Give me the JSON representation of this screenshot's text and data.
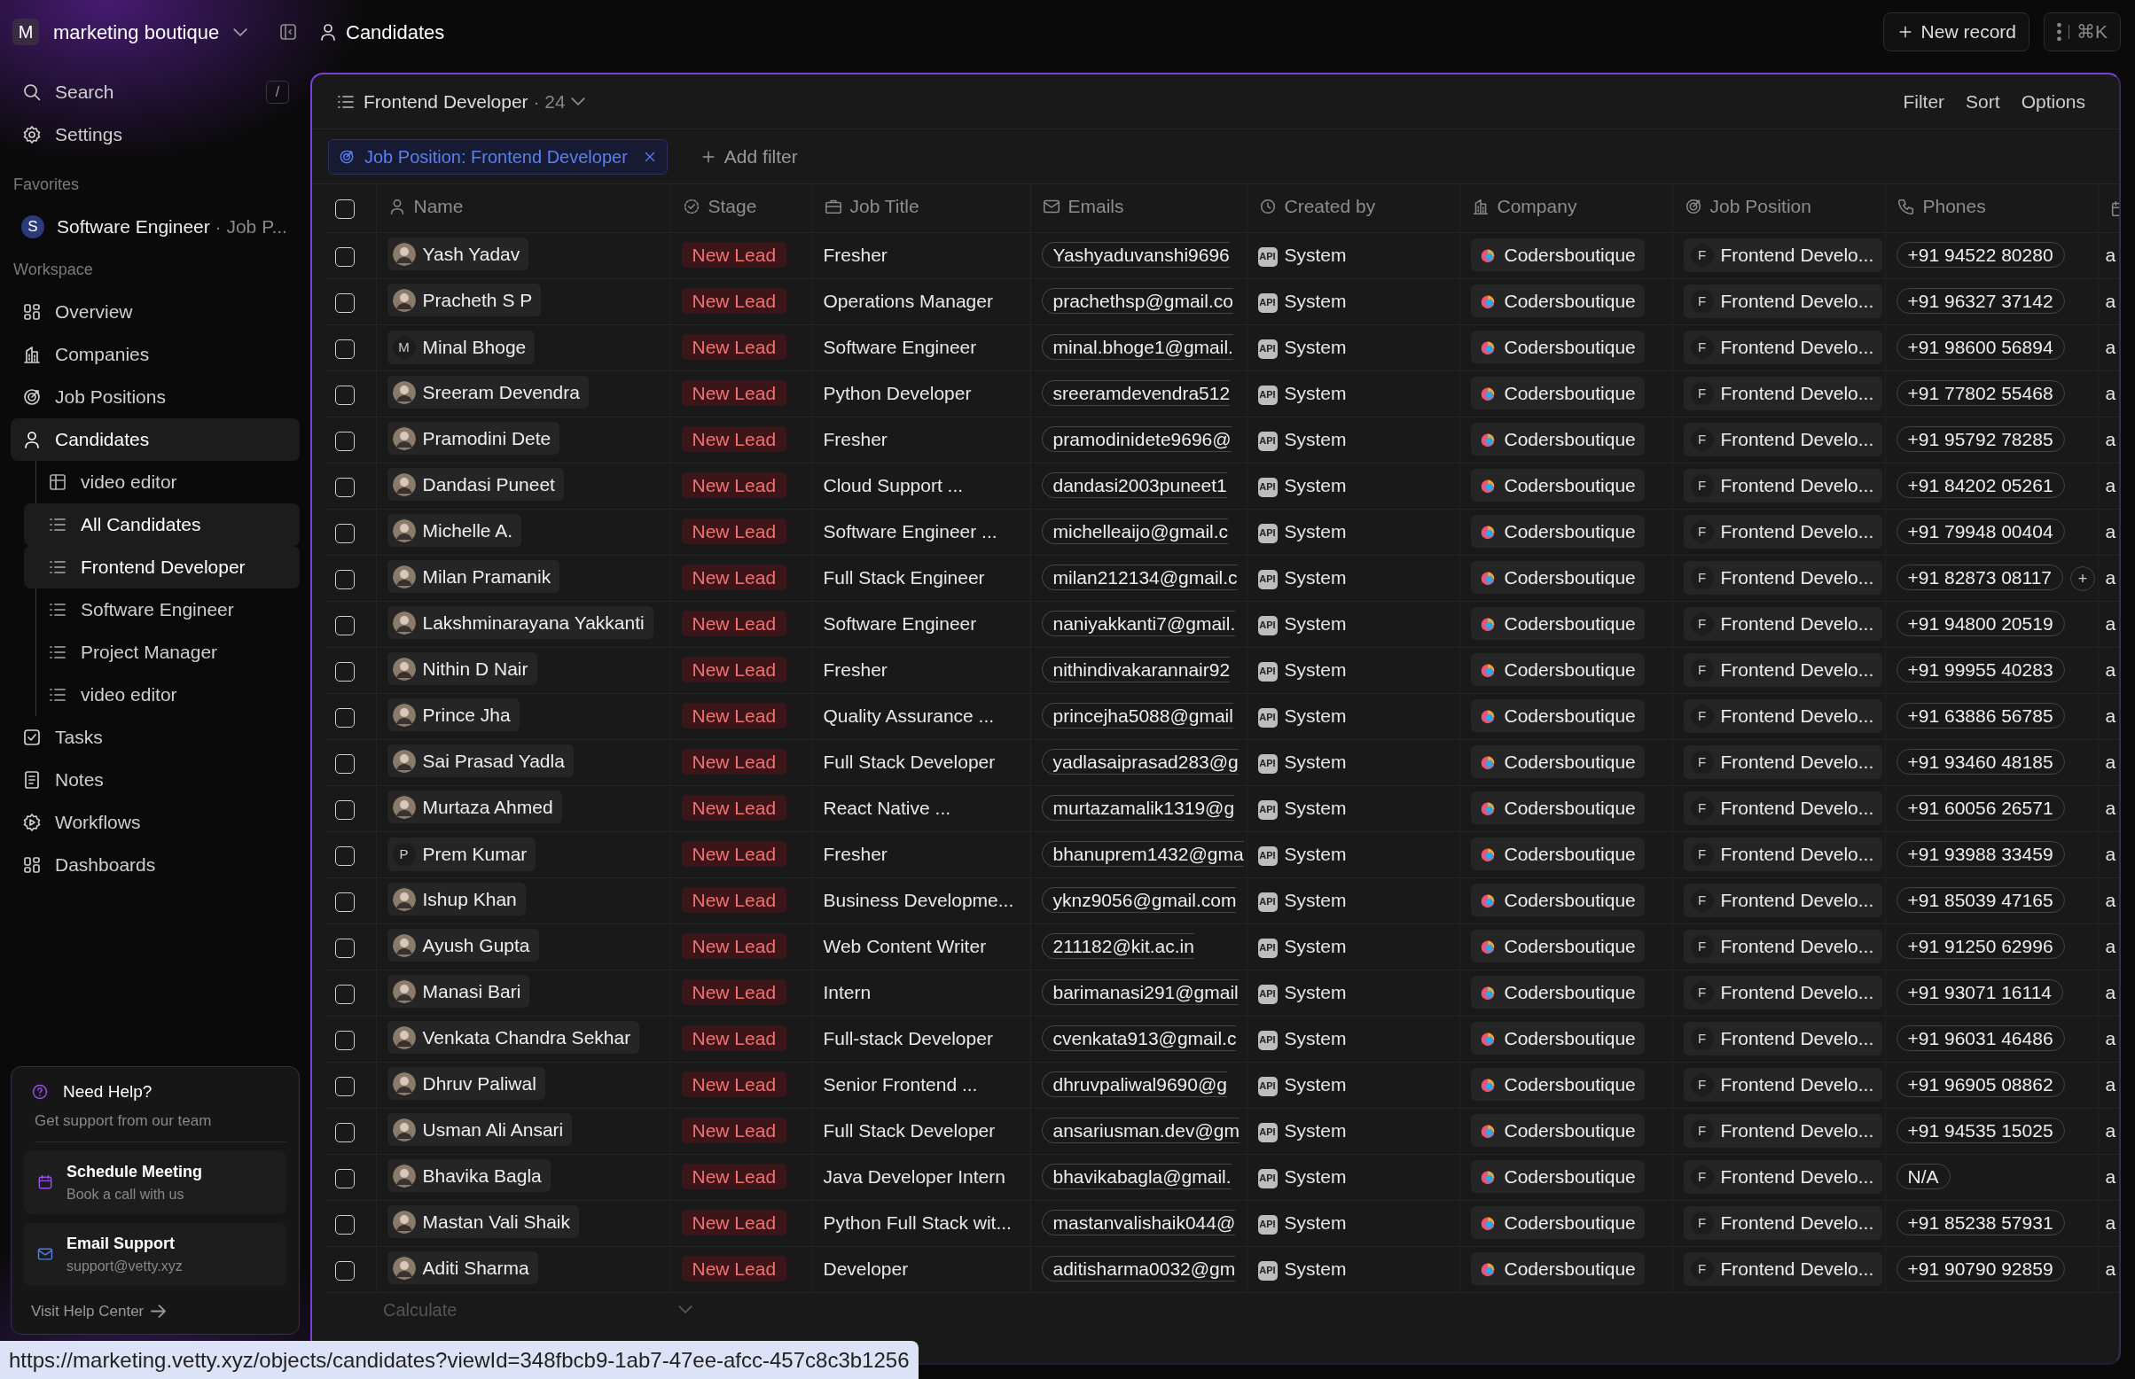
{
  "topbar": {
    "workspace_letter": "M",
    "workspace": "marketing boutique",
    "page": "Candidates",
    "new_record": "New record",
    "shortcut": "⌘K"
  },
  "sidebar": {
    "search": "Search",
    "search_key": "/",
    "settings": "Settings",
    "favorites_label": "Favorites",
    "favorites": [
      {
        "letter": "S",
        "label": "Software Engineer",
        "suffix": "· Job P..."
      }
    ],
    "workspace_label": "Workspace",
    "items": [
      {
        "label": "Overview",
        "selected": false
      },
      {
        "label": "Companies",
        "selected": false
      },
      {
        "label": "Job Positions",
        "selected": false
      },
      {
        "label": "Candidates",
        "selected": true,
        "children": [
          {
            "label": "video editor",
            "kind": "table",
            "selected": false
          },
          {
            "label": "All Candidates",
            "kind": "list",
            "selected": true
          },
          {
            "label": "Frontend Developer",
            "kind": "list",
            "selected": true
          },
          {
            "label": "Software Engineer",
            "kind": "list",
            "selected": false
          },
          {
            "label": "Project Manager",
            "kind": "list",
            "selected": false
          },
          {
            "label": "video editor",
            "kind": "list",
            "selected": false
          }
        ]
      },
      {
        "label": "Tasks",
        "selected": false
      },
      {
        "label": "Notes",
        "selected": false
      },
      {
        "label": "Workflows",
        "selected": false
      },
      {
        "label": "Dashboards",
        "selected": false
      }
    ],
    "help": {
      "title": "Need Help?",
      "subtitle": "Get support from our team",
      "actions": [
        {
          "title": "Schedule Meeting",
          "detail": "Book a call with us"
        },
        {
          "title": "Email Support",
          "detail": "support@vetty.xyz"
        }
      ],
      "link": "Visit Help Center"
    }
  },
  "view": {
    "title": "Frontend Developer",
    "count": "· 24",
    "actions": [
      "Filter",
      "Sort",
      "Options"
    ],
    "filter": {
      "label": "Job Position: Frontend Developer"
    },
    "add_filter": "Add filter"
  },
  "table": {
    "header_checked": false,
    "columns": [
      "Name",
      "Stage",
      "Job Title",
      "Emails",
      "Created by",
      "Company",
      "Job Position",
      "Phones"
    ],
    "rows": [
      {
        "checked": false,
        "name": "Yash Yadav",
        "avatar": {
          "kind": "photo"
        },
        "stage": "New Lead",
        "job_title": "Fresher",
        "email": "Yashyaduvanshi9696",
        "created_by": {
          "badge": "API",
          "name": "System"
        },
        "company": "Codersboutique",
        "job_position": {
          "letter": "F",
          "label": "Frontend Develo..."
        },
        "phone": "+91 94522 80280",
        "column_10": "a"
      },
      {
        "checked": false,
        "name": "Pracheth S P",
        "avatar": {
          "kind": "photo"
        },
        "stage": "New Lead",
        "job_title": "Operations Manager",
        "email": "prachethsp@gmail.co",
        "created_by": {
          "badge": "API",
          "name": "System"
        },
        "company": "Codersboutique",
        "job_position": {
          "letter": "F",
          "label": "Frontend Develo..."
        },
        "phone": "+91 96327 37142",
        "column_10": "a"
      },
      {
        "checked": false,
        "name": "Minal Bhoge",
        "avatar": {
          "kind": "letter",
          "letter": "M"
        },
        "stage": "New Lead",
        "job_title": "Software Engineer",
        "email": "minal.bhoge1@gmail.",
        "created_by": {
          "badge": "API",
          "name": "System"
        },
        "company": "Codersboutique",
        "job_position": {
          "letter": "F",
          "label": "Frontend Develo..."
        },
        "phone": "+91 98600 56894",
        "column_10": "a"
      },
      {
        "checked": false,
        "name": "Sreeram Devendra",
        "avatar": {
          "kind": "photo"
        },
        "stage": "New Lead",
        "job_title": "Python Developer",
        "email": "sreeramdevendra512",
        "created_by": {
          "badge": "API",
          "name": "System"
        },
        "company": "Codersboutique",
        "job_position": {
          "letter": "F",
          "label": "Frontend Develo..."
        },
        "phone": "+91 77802 55468",
        "column_10": "a"
      },
      {
        "checked": false,
        "name": "Pramodini Dete",
        "avatar": {
          "kind": "photo"
        },
        "stage": "New Lead",
        "job_title": "Fresher",
        "email": "pramodinidete9696@",
        "created_by": {
          "badge": "API",
          "name": "System"
        },
        "company": "Codersboutique",
        "job_position": {
          "letter": "F",
          "label": "Frontend Develo..."
        },
        "phone": "+91 95792 78285",
        "column_10": "a"
      },
      {
        "checked": false,
        "name": "Dandasi Puneet",
        "avatar": {
          "kind": "photo"
        },
        "stage": "New Lead",
        "job_title": "Cloud Support ...",
        "email": "dandasi2003puneet1",
        "created_by": {
          "badge": "API",
          "name": "System"
        },
        "company": "Codersboutique",
        "job_position": {
          "letter": "F",
          "label": "Frontend Develo..."
        },
        "phone": "+91 84202 05261",
        "column_10": "a"
      },
      {
        "checked": false,
        "name": "Michelle A.",
        "avatar": {
          "kind": "photo"
        },
        "stage": "New Lead",
        "job_title": "Software Engineer ...",
        "email": "michelleaijo@gmail.c",
        "created_by": {
          "badge": "API",
          "name": "System"
        },
        "company": "Codersboutique",
        "job_position": {
          "letter": "F",
          "label": "Frontend Develo..."
        },
        "phone": "+91 79948 00404",
        "column_10": "a"
      },
      {
        "checked": false,
        "name": "Milan Pramanik",
        "avatar": {
          "kind": "photo"
        },
        "stage": "New Lead",
        "job_title": "Full Stack Engineer",
        "email": "milan212134@gmail.c",
        "created_by": {
          "badge": "API",
          "name": "System"
        },
        "company": "Codersboutique",
        "job_position": {
          "letter": "F",
          "label": "Frontend Develo..."
        },
        "phone": "+91 82873 08117",
        "phone_add": "+",
        "column_10": "a"
      },
      {
        "checked": false,
        "name": "Lakshminarayana Yakkanti",
        "avatar": {
          "kind": "photo"
        },
        "stage": "New Lead",
        "job_title": "Software Engineer",
        "email": "naniyakkanti7@gmail.",
        "created_by": {
          "badge": "API",
          "name": "System"
        },
        "company": "Codersboutique",
        "job_position": {
          "letter": "F",
          "label": "Frontend Develo..."
        },
        "phone": "+91 94800 20519",
        "column_10": "a"
      },
      {
        "checked": false,
        "name": "Nithin D Nair",
        "avatar": {
          "kind": "photo"
        },
        "stage": "New Lead",
        "job_title": "Fresher",
        "email": "nithindivakarannair92",
        "created_by": {
          "badge": "API",
          "name": "System"
        },
        "company": "Codersboutique",
        "job_position": {
          "letter": "F",
          "label": "Frontend Develo..."
        },
        "phone": "+91 99955 40283",
        "column_10": "a"
      },
      {
        "checked": false,
        "name": "Prince Jha",
        "avatar": {
          "kind": "photo"
        },
        "stage": "New Lead",
        "job_title": "Quality Assurance ...",
        "email": "princejha5088@gmail",
        "created_by": {
          "badge": "API",
          "name": "System"
        },
        "company": "Codersboutique",
        "job_position": {
          "letter": "F",
          "label": "Frontend Develo..."
        },
        "phone": "+91 63886 56785",
        "column_10": "a"
      },
      {
        "checked": false,
        "name": "Sai Prasad Yadla",
        "avatar": {
          "kind": "photo"
        },
        "stage": "New Lead",
        "job_title": "Full Stack Developer",
        "email": "yadlasaiprasad283@g",
        "created_by": {
          "badge": "API",
          "name": "System"
        },
        "company": "Codersboutique",
        "job_position": {
          "letter": "F",
          "label": "Frontend Develo..."
        },
        "phone": "+91 93460 48185",
        "column_10": "a"
      },
      {
        "checked": false,
        "name": "Murtaza Ahmed",
        "avatar": {
          "kind": "photo"
        },
        "stage": "New Lead",
        "job_title": "React Native ...",
        "email": "murtazamalik1319@g",
        "created_by": {
          "badge": "API",
          "name": "System"
        },
        "company": "Codersboutique",
        "job_position": {
          "letter": "F",
          "label": "Frontend Develo..."
        },
        "phone": "+91 60056 26571",
        "column_10": "a"
      },
      {
        "checked": false,
        "name": "Prem Kumar",
        "avatar": {
          "kind": "letter",
          "letter": "P"
        },
        "stage": "New Lead",
        "job_title": "Fresher",
        "email": "bhanuprem1432@gma",
        "created_by": {
          "badge": "API",
          "name": "System"
        },
        "company": "Codersboutique",
        "job_position": {
          "letter": "F",
          "label": "Frontend Develo..."
        },
        "phone": "+91 93988 33459",
        "column_10": "a"
      },
      {
        "checked": false,
        "name": "Ishup Khan",
        "avatar": {
          "kind": "photo"
        },
        "stage": "New Lead",
        "job_title": "Business Developme...",
        "email": "yknz9056@gmail.com",
        "created_by": {
          "badge": "API",
          "name": "System"
        },
        "company": "Codersboutique",
        "job_position": {
          "letter": "F",
          "label": "Frontend Develo..."
        },
        "phone": "+91 85039 47165",
        "column_10": "a"
      },
      {
        "checked": false,
        "name": "Ayush Gupta",
        "avatar": {
          "kind": "photo"
        },
        "stage": "New Lead",
        "job_title": "Web Content Writer",
        "email": "211182@kit.ac.in",
        "created_by": {
          "badge": "API",
          "name": "System"
        },
        "company": "Codersboutique",
        "job_position": {
          "letter": "F",
          "label": "Frontend Develo..."
        },
        "phone": "+91 91250 62996",
        "column_10": "a"
      },
      {
        "checked": false,
        "name": "Manasi Bari",
        "avatar": {
          "kind": "photo"
        },
        "stage": "New Lead",
        "job_title": "Intern",
        "email": "barimanasi291@gmail",
        "created_by": {
          "badge": "API",
          "name": "System"
        },
        "company": "Codersboutique",
        "job_position": {
          "letter": "F",
          "label": "Frontend Develo..."
        },
        "phone": "+91 93071 16114",
        "column_10": "a"
      },
      {
        "checked": false,
        "name": "Venkata Chandra Sekhar",
        "avatar": {
          "kind": "photo"
        },
        "stage": "New Lead",
        "job_title": "Full-stack Developer",
        "email": "cvenkata913@gmail.c",
        "created_by": {
          "badge": "API",
          "name": "System"
        },
        "company": "Codersboutique",
        "job_position": {
          "letter": "F",
          "label": "Frontend Develo..."
        },
        "phone": "+91 96031 46486",
        "column_10": "a"
      },
      {
        "checked": false,
        "name": "Dhruv Paliwal",
        "avatar": {
          "kind": "photo"
        },
        "stage": "New Lead",
        "job_title": "Senior Frontend ...",
        "email": "dhruvpaliwal9690@g",
        "created_by": {
          "badge": "API",
          "name": "System"
        },
        "company": "Codersboutique",
        "job_position": {
          "letter": "F",
          "label": "Frontend Develo..."
        },
        "phone": "+91 96905 08862",
        "column_10": "a"
      },
      {
        "checked": false,
        "name": "Usman Ali Ansari",
        "avatar": {
          "kind": "photo"
        },
        "stage": "New Lead",
        "job_title": "Full Stack Developer",
        "email": "ansariusman.dev@gm",
        "created_by": {
          "badge": "API",
          "name": "System"
        },
        "company": "Codersboutique",
        "job_position": {
          "letter": "F",
          "label": "Frontend Develo..."
        },
        "phone": "+91 94535 15025",
        "column_10": "a"
      },
      {
        "checked": false,
        "name": "Bhavika Bagla",
        "avatar": {
          "kind": "photo"
        },
        "stage": "New Lead",
        "job_title": "Java Developer Intern",
        "email": "bhavikabagla@gmail.",
        "created_by": {
          "badge": "API",
          "name": "System"
        },
        "company": "Codersboutique",
        "job_position": {
          "letter": "F",
          "label": "Frontend Develo..."
        },
        "phone": "N/A",
        "column_10": "a"
      },
      {
        "checked": false,
        "name": "Mastan Vali Shaik",
        "avatar": {
          "kind": "photo"
        },
        "stage": "New Lead",
        "job_title": "Python Full Stack wit...",
        "email": "mastanvalishaik044@",
        "created_by": {
          "badge": "API",
          "name": "System"
        },
        "company": "Codersboutique",
        "job_position": {
          "letter": "F",
          "label": "Frontend Develo..."
        },
        "phone": "+91 85238 57931",
        "column_10": "a"
      },
      {
        "checked": false,
        "name": "Aditi Sharma",
        "avatar": {
          "kind": "photo"
        },
        "stage": "New Lead",
        "job_title": "Developer",
        "email": "aditisharma0032@gm",
        "created_by": {
          "badge": "API",
          "name": "System"
        },
        "company": "Codersboutique",
        "job_position": {
          "letter": "F",
          "label": "Frontend Develo..."
        },
        "phone": "+91 90790 92859",
        "column_10": "a"
      }
    ],
    "footer": "Calculate"
  },
  "status_bar": {
    "url": "https://marketing.vetty.xyz/objects/candidates?viewId=348fbcb9-1ab7-47ee-afcc-457c8c3b1256"
  }
}
